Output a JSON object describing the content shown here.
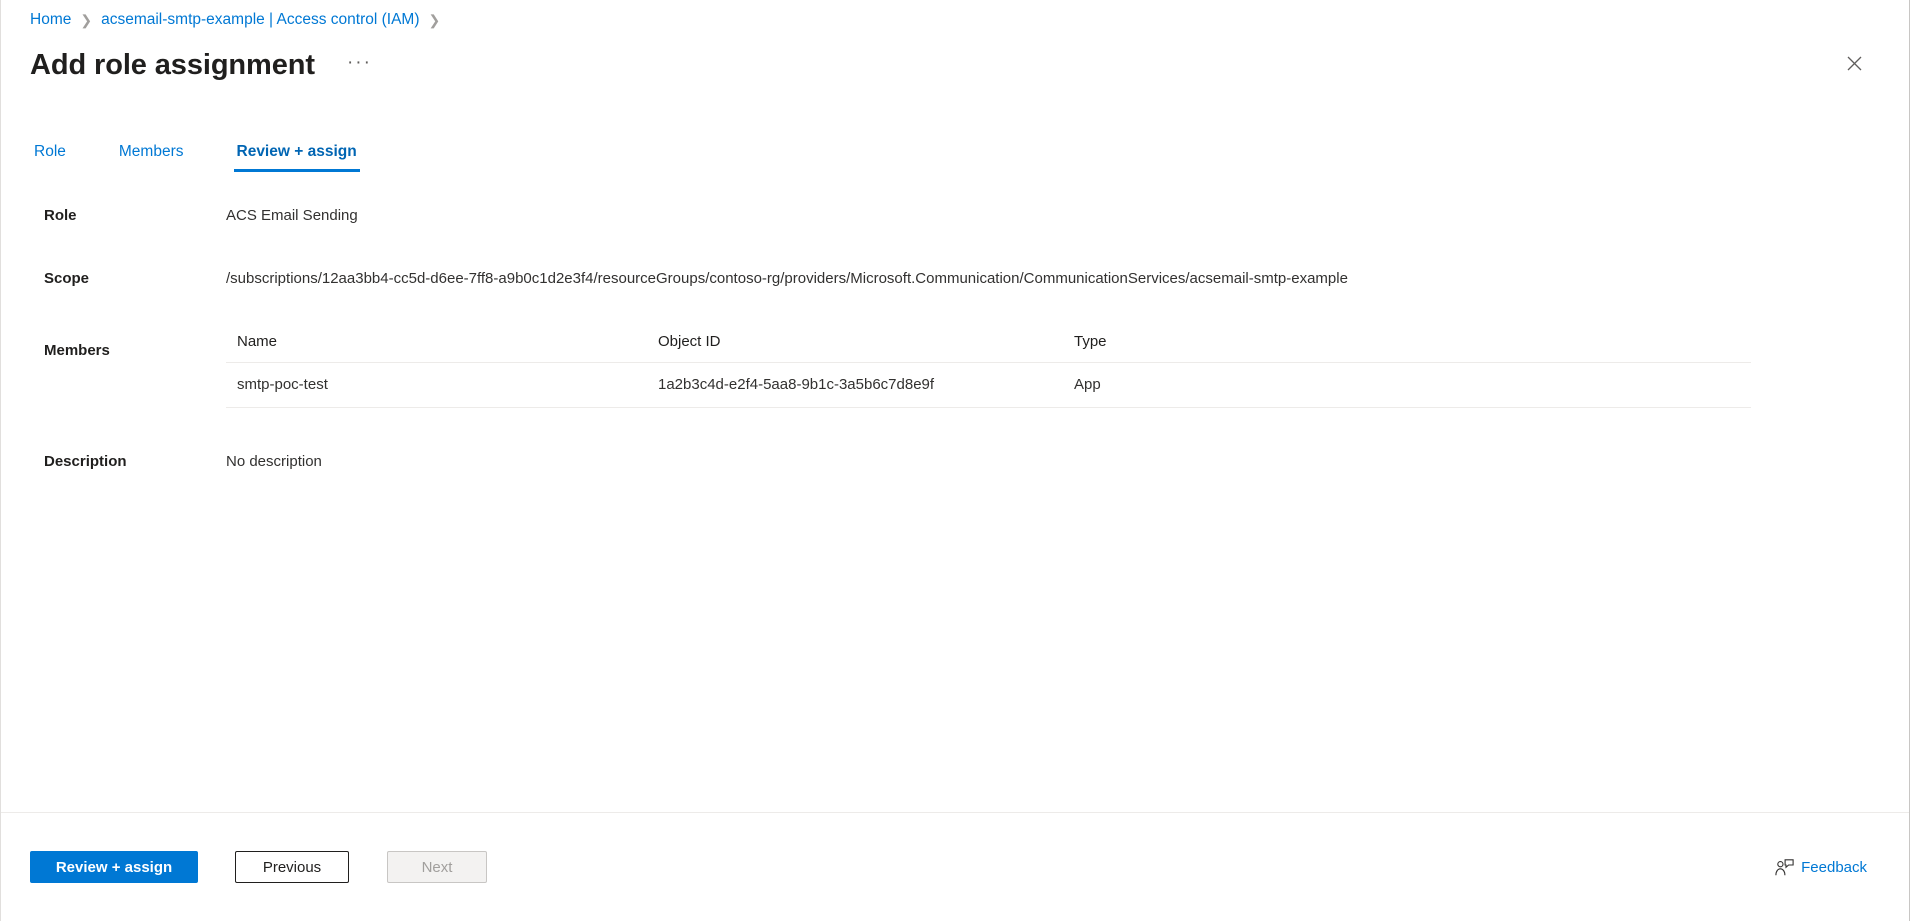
{
  "breadcrumb": {
    "items": [
      {
        "label": "Home"
      },
      {
        "label": "acsemail-smtp-example | Access control (IAM)"
      }
    ],
    "separator": "❯"
  },
  "header": {
    "title": "Add role assignment",
    "ellipsis_label": "···",
    "close_label": "✕"
  },
  "tabs": [
    {
      "label": "Role",
      "active": false
    },
    {
      "label": "Members",
      "active": false
    },
    {
      "label": "Review + assign",
      "active": true
    }
  ],
  "fields": {
    "role": {
      "label": "Role",
      "value": "ACS Email Sending"
    },
    "scope": {
      "label": "Scope",
      "value": "/subscriptions/12aa3bb4-cc5d-d6ee-7ff8-a9b0c1d2e3f4/resourceGroups/contoso-rg/providers/Microsoft.Communication/CommunicationServices/acsemail-smtp-example"
    },
    "members": {
      "label": "Members",
      "columns": [
        "Name",
        "Object ID",
        "Type"
      ],
      "rows": [
        {
          "name": "smtp-poc-test",
          "object_id": "1a2b3c4d-e2f4-5aa8-9b1c-3a5b6c7d8e9f",
          "type": "App"
        }
      ]
    },
    "description": {
      "label": "Description",
      "value": "No description"
    }
  },
  "footer": {
    "primary_label": "Review + assign",
    "previous_label": "Previous",
    "next_label": "Next",
    "feedback_label": "Feedback"
  },
  "colors": {
    "accent": "#0078d4",
    "link": "#0078d4",
    "text": "#201f1e",
    "disabled_text": "#a19f9d",
    "divider": "#edebe9"
  }
}
